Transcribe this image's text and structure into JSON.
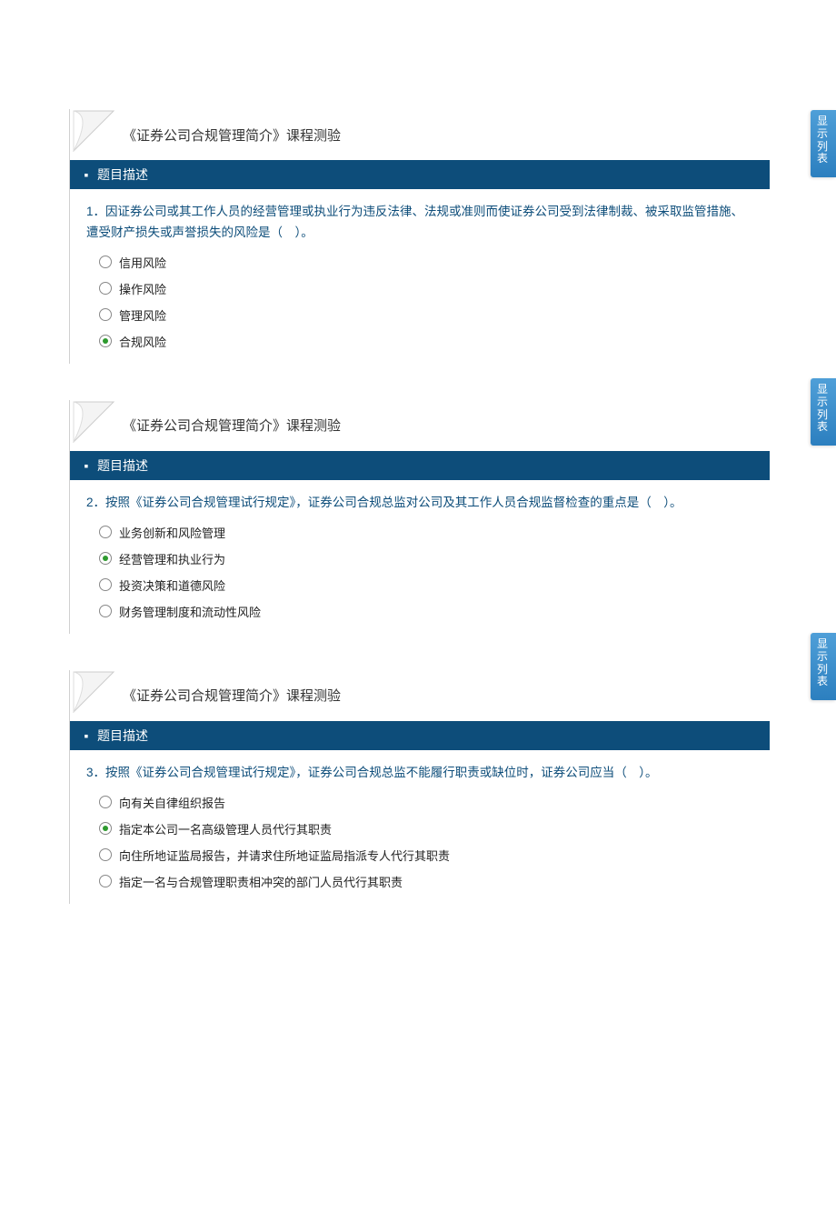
{
  "side_tab_label": "显示列表",
  "questions": [
    {
      "title": "《证券公司合规管理简介》课程测验",
      "desc_header": "题目描述",
      "number": "1．",
      "text": "因证券公司或其工作人员的经营管理或执业行为违反法律、法规或准则而使证券公司受到法律制裁、被采取监管措施、遭受财产损失或声誉损失的风险是（　）。",
      "options": [
        {
          "label": "信用风险",
          "selected": false
        },
        {
          "label": "操作风险",
          "selected": false
        },
        {
          "label": "管理风险",
          "selected": false
        },
        {
          "label": "合规风险",
          "selected": true
        }
      ]
    },
    {
      "title": "《证券公司合规管理简介》课程测验",
      "desc_header": "题目描述",
      "number": "2．",
      "text": "按照《证券公司合规管理试行规定》，证券公司合规总监对公司及其工作人员合规监督检查的重点是（　）。",
      "options": [
        {
          "label": "业务创新和风险管理",
          "selected": false
        },
        {
          "label": "经营管理和执业行为",
          "selected": true
        },
        {
          "label": "投资决策和道德风险",
          "selected": false
        },
        {
          "label": "财务管理制度和流动性风险",
          "selected": false
        }
      ]
    },
    {
      "title": "《证券公司合规管理简介》课程测验",
      "desc_header": "题目描述",
      "number": "3．",
      "text": "按照《证券公司合规管理试行规定》，证券公司合规总监不能履行职责或缺位时，证券公司应当（　）。",
      "options": [
        {
          "label": "向有关自律组织报告",
          "selected": false
        },
        {
          "label": "指定本公司一名高级管理人员代行其职责",
          "selected": true
        },
        {
          "label": "向住所地证监局报告，并请求住所地证监局指派专人代行其职责",
          "selected": false
        },
        {
          "label": "指定一名与合规管理职责相冲突的部门人员代行其职责",
          "selected": false
        }
      ]
    }
  ]
}
